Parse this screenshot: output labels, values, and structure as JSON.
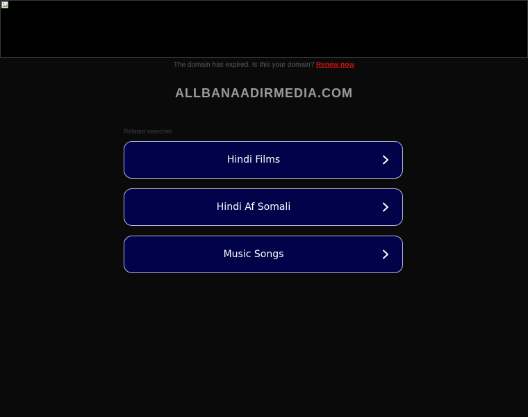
{
  "expired": {
    "message": "The domain has expired. Is this your domain?",
    "renew_label": "Renew now"
  },
  "domain": "ALLBANAADIRMEDIA.COM",
  "related": {
    "label": "Related searches",
    "items": [
      {
        "label": "Hindi Films"
      },
      {
        "label": "Hindi Af Somali"
      },
      {
        "label": "Music Songs"
      }
    ]
  },
  "colors": {
    "background": "#0a0a0a",
    "button_fill": "#02024a",
    "button_border": "#b9b9d9",
    "renew_link": "#d01414"
  }
}
